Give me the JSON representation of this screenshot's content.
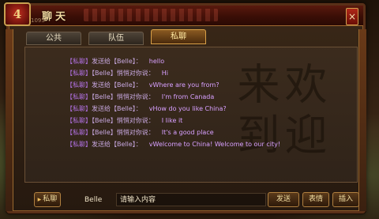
{
  "window": {
    "title": "聊天",
    "subtitle": "1093",
    "emblem_glyph": "4",
    "close_label": "×"
  },
  "tabs": [
    {
      "label": "公共",
      "active": false
    },
    {
      "label": "队伍",
      "active": false
    },
    {
      "label": "私聊",
      "active": true
    }
  ],
  "watermark": "欢迎来到",
  "messages": [
    {
      "tag": "【私聊】",
      "text": "发送给【Belle】：",
      "body": "hello"
    },
    {
      "tag": "【私聊】",
      "text": "【Belle】悄悄对你说：",
      "body": "Hi"
    },
    {
      "tag": "【私聊】",
      "text": "发送给【Belle】：",
      "body": "vWhere are you from?"
    },
    {
      "tag": "【私聊】",
      "text": "【Belle】悄悄对你说：",
      "body": "I'm from Canada"
    },
    {
      "tag": "【私聊】",
      "text": "发送给【Belle】：",
      "body": "vHow do you like China?"
    },
    {
      "tag": "【私聊】",
      "text": "【Belle】悄悄对你说：",
      "body": "I like it"
    },
    {
      "tag": "【私聊】",
      "text": "【Belle】悄悄对你说：",
      "body": "It's a good place"
    },
    {
      "tag": "【私聊】",
      "text": "发送给【Belle】：",
      "body": "vWelcome to China! Welcome to our city!"
    }
  ],
  "input_bar": {
    "channel_label": "私聊",
    "target_value": "Belle",
    "message_placeholder": "请输入内容",
    "send_label": "发送",
    "emote_label": "表情",
    "insert_label": "插入"
  },
  "colors": {
    "accent": "#d8a048",
    "message_text": "#d8a0ff",
    "title_bar": "#5a1a0e"
  }
}
